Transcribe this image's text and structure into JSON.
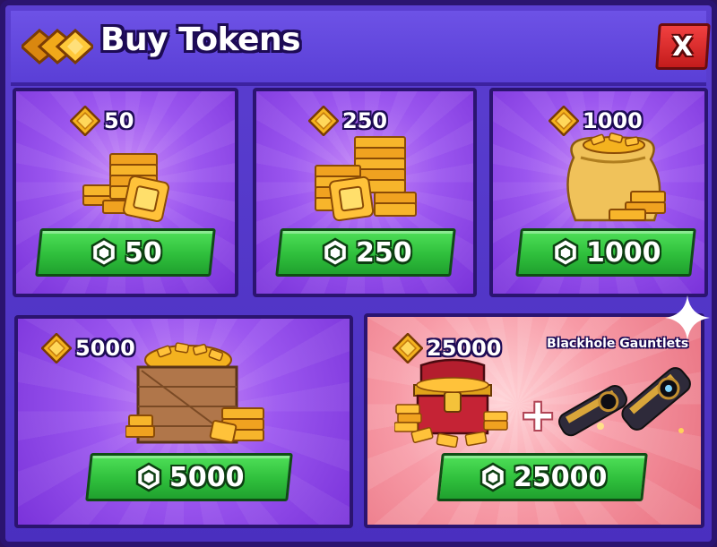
{
  "header": {
    "title": "Buy Tokens",
    "close_label": "X"
  },
  "colors": {
    "panel_purple": "#5b3fd1",
    "card_purple": "#9b56ef",
    "card_pink": "#f79aa6",
    "buy_green": "#2fbf3c",
    "close_red": "#d42a2a",
    "token_gold": "#f4b21f"
  },
  "offers": [
    {
      "tokens": "50",
      "price": "50",
      "art": "token-stack-icon"
    },
    {
      "tokens": "250",
      "price": "250",
      "art": "token-pile-icon"
    },
    {
      "tokens": "1000",
      "price": "1000",
      "art": "token-sack-icon"
    },
    {
      "tokens": "5000",
      "price": "5000",
      "art": "token-crate-icon"
    },
    {
      "tokens": "25000",
      "price": "25000",
      "art": "treasure-chest-icon",
      "bonus": "Blackhole Gauntlets",
      "plus": "+"
    }
  ]
}
